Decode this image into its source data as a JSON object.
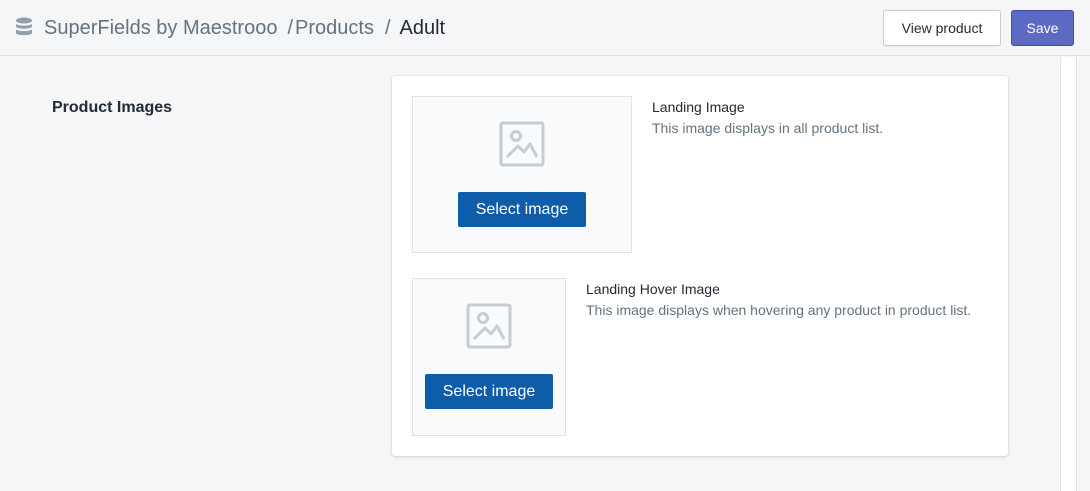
{
  "header": {
    "app_name": "SuperFields by Maestrooo",
    "sep1": "/",
    "section": "Products",
    "sep2": "/",
    "current": "Adult",
    "app_icon": "database-icon"
  },
  "actions": {
    "view_product_label": "View product",
    "save_label": "Save"
  },
  "section": {
    "title": "Product Images"
  },
  "fields": [
    {
      "label": "Landing Image",
      "help": "This image displays in all product list.",
      "button_label": "Select image",
      "icon": "image-placeholder-icon"
    },
    {
      "label": "Landing Hover Image",
      "help": "This image displays when hovering any product in product list.",
      "button_label": "Select image",
      "icon": "image-placeholder-icon"
    }
  ],
  "colors": {
    "primary": "#5c6ac4",
    "select_button": "#0f5ca8",
    "background": "#f4f6f8"
  }
}
